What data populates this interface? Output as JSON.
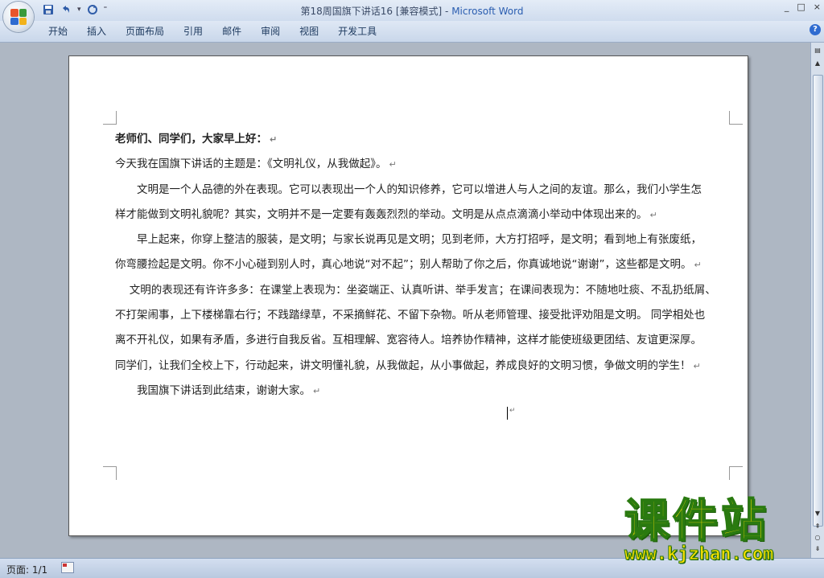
{
  "window": {
    "doc_title": "第18周国旗下讲话16 [兼容模式]",
    "separator": " - ",
    "app_name": "Microsoft Word",
    "controls": [
      "_",
      "□",
      "×"
    ]
  },
  "quick_access": {
    "icons": [
      "save-icon",
      "undo-icon",
      "redo-icon"
    ],
    "dropdown": "▾",
    "customize": "⁼"
  },
  "ribbon": {
    "tabs": [
      "开始",
      "插入",
      "页面布局",
      "引用",
      "邮件",
      "审阅",
      "视图",
      "开发工具"
    ],
    "help": "?"
  },
  "document": {
    "paragraphs": [
      "老师们、同学们，大家早上好：",
      "今天我在国旗下讲话的主题是：《文明礼仪，从我做起》。",
      "　　文明是一个人品德的外在表现。它可以表现出一个人的知识修养，它可以增进人与人之间的友谊。那么，我们小学生怎",
      "样才能做到文明礼貌呢？其实，文明并不是一定要有轰轰烈烈的举动。文明是从点点滴滴小举动中体现出来的。",
      "　　早上起来，你穿上整洁的服装，是文明；与家长说再见是文明；见到老师，大方打招呼，是文明；看到地上有张废纸，",
      "你弯腰捡起是文明。你不小心碰到别人时，真心地说“对不起”；别人帮助了你之后，你真诚地说“谢谢”，这些都是文明。",
      "　 文明的表现还有许许多多：在课堂上表现为：坐姿端正、认真听讲、举手发言；在课间表现为：不随地吐痰、不乱扔纸屑、",
      "不打架闹事，上下楼梯靠右行；不践踏绿草，不采摘鲜花、不留下杂物。听从老师管理、接受批评劝阻是文明。 同学相处也",
      "离不开礼仪，如果有矛盾，多进行自我反省。互相理解、宽容待人。培养协作精神，这样才能使班级更团结、友谊更深厚。",
      "同学们，让我们全校上下，行动起来，讲文明懂礼貌，从我做起，从小事做起，养成良好的文明习惯，争做文明的学生！",
      "　　我国旗下讲话到此结束，谢谢大家。"
    ],
    "return_mark": "↵"
  },
  "status_bar": {
    "page_label": "页面: 1/1"
  },
  "watermark": {
    "title": "课件站",
    "url": "www.kjzhan.com"
  },
  "colors": {
    "app_name": "#2a5db0",
    "workspace": "#aeb7c3",
    "watermark_fill": "#ffe000",
    "watermark_stroke": "#2a7a10"
  }
}
